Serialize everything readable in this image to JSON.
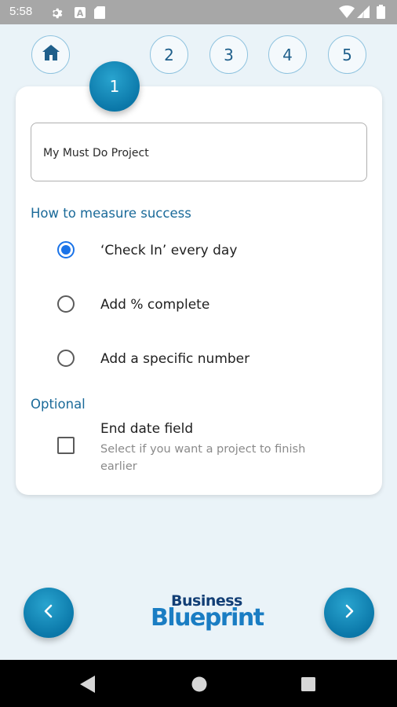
{
  "status_bar": {
    "time": "5:58",
    "left_icons": [
      "gear-icon",
      "app-a-icon",
      "sd-card-icon"
    ],
    "right_icons": [
      "wifi-icon",
      "signal-icon",
      "battery-icon"
    ]
  },
  "steps": {
    "home_icon": "home-icon",
    "active": "1",
    "items": [
      "2",
      "3",
      "4",
      "5"
    ]
  },
  "project": {
    "name_value": "My Must Do Project"
  },
  "measure": {
    "title": "How to measure success",
    "options": [
      {
        "label": "‘Check In’ every day",
        "selected": true
      },
      {
        "label": "Add % complete",
        "selected": false
      },
      {
        "label": "Add a specific number",
        "selected": false
      }
    ]
  },
  "optional": {
    "title": "Optional",
    "end_date": {
      "label": "End date field",
      "description": "Select if you want a project to finish earlier",
      "checked": false
    }
  },
  "navigation": {
    "back_icon": "chevron-left-icon",
    "next_icon": "chevron-right-icon"
  },
  "logo": {
    "line1": "Business",
    "line2": "Blueprint"
  },
  "colors": {
    "accent": "#0b78a9",
    "section_title": "#1a6a99",
    "radio_selected": "#1a73e8",
    "background": "#eaf3f8"
  },
  "android_nav": [
    "back-triangle-icon",
    "home-circle-icon",
    "recents-square-icon"
  ]
}
